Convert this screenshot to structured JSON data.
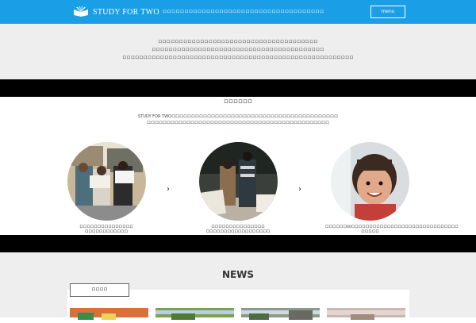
{
  "header": {
    "logo_text": "STUDY FOR TWO",
    "tagline": "ロロロロロロロロロロロロロロロロロロロロロロロロロロロロロロロロロロロロロ",
    "menu_label": "menu"
  },
  "intro": {
    "lines": [
      "ロロロロロロロロロロロロロロロロロロロロロロロロロロロロロロロロロロロロロロ",
      "ロロロロロロロロロロロロロロロロロロロロロロロロロロロロロロロロロロロロロロロロロ",
      "ロロロロロロロロロロロロロロロロロロロロロロロロロロロロロロロロロロロロロロロロロロロロロロロロロロロロロロロ"
    ]
  },
  "activity": {
    "title": "ロロロロロロ",
    "desc_line1": "STUDY FOR TWOロロロロロロロロロロロロロロロロロロロロロロロロロロロロロロロロロロロロロロロロロロ",
    "desc_line2": "ロロロロロロロロロロロロロロロロロロロロロロロロロロロロロロロロロロロロロロロロロロロロロロ",
    "steps": [
      {
        "caption1": "ロロロロロロロロロロロロロロロ",
        "caption2": "ロロロロロロロロロロロロ"
      },
      {
        "caption1": "ロロロロロロロロロロロロロロロ",
        "caption2": "ロロロロロロロロロロロロロロロロロロ"
      },
      {
        "caption1": "ロロロロロロ60ロロロロロロロロロロロロロロロロロロロロロロロロロロロロロロ",
        "caption2": "ロロロロロ"
      }
    ],
    "arrow": "›"
  },
  "news": {
    "title": "NEWS",
    "tab_label": "ロロロロ"
  },
  "colors": {
    "header_bg": "#1a9fe6",
    "intro_bg": "#eeeeee",
    "band": "#000000"
  },
  "icons": {
    "logo": "open-book-icon",
    "arrow": "chevron-right-icon"
  }
}
